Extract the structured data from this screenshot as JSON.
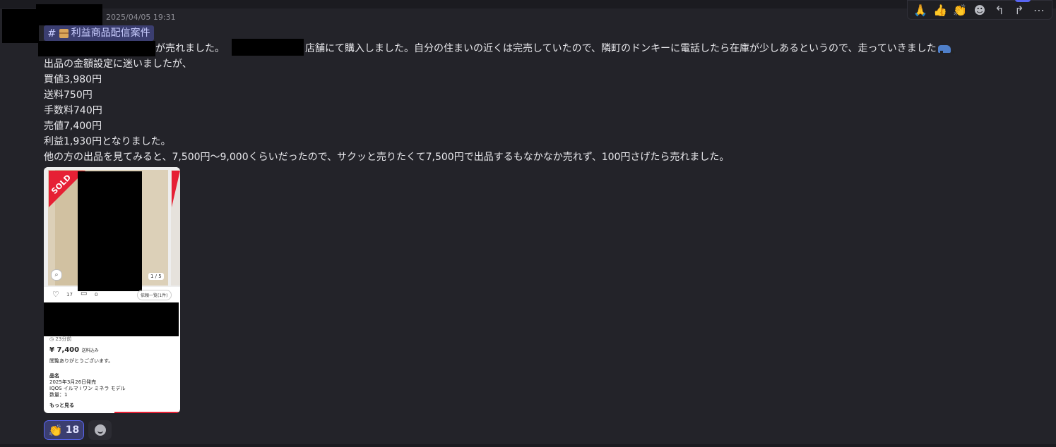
{
  "message": {
    "timestamp": "2025/04/05 19:31",
    "channel_name": "利益商品配信案件",
    "lines": [
      "が売れました。",
      "店舗にて購入しました。自分の住まいの近くは完売していたので、隣町のドンキーに電話したら在庫が少しあるというので、走っていきました",
      "出品の金額設定に迷いましたが、",
      "買値3,980円",
      "送料750円",
      "手数料740円",
      "売値7,400円",
      "利益1,930円となりました。",
      "他の方の出品を見てみると、7,500円〜9,000くらいだったので、サクッと売りたくて7,500円で出品するもなかなか売れず、100円さげたら売れました。"
    ]
  },
  "attachment": {
    "sold_label": "SOLD",
    "page_indicator": "1 / 5",
    "likes": "17",
    "comments": "0",
    "list_button": "依頼一覧(1件)",
    "time_ago": "23分前",
    "price": "¥ 7,400",
    "shipping": "送料込み",
    "greeting": "閲覧ありがとうございます。",
    "item_name_label": "品名",
    "release": "2025年3月26日発売",
    "product": "IQOS イルマ i ワン ミネラ モデル",
    "quantity": "数量：1",
    "more": "もっと見る"
  },
  "reactions": {
    "clap_count": "18"
  },
  "icons": [
    "hash-icon",
    "package-icon",
    "car-icon",
    "pray-icon",
    "thumbs-up-icon",
    "clap-icon",
    "add-reaction-icon",
    "reply-icon",
    "forward-icon",
    "more-icon"
  ],
  "colors": {
    "background": "#232329",
    "mention_bg": "#3b3e70",
    "accent": "#5865f2",
    "sold_red": "#e62034"
  }
}
